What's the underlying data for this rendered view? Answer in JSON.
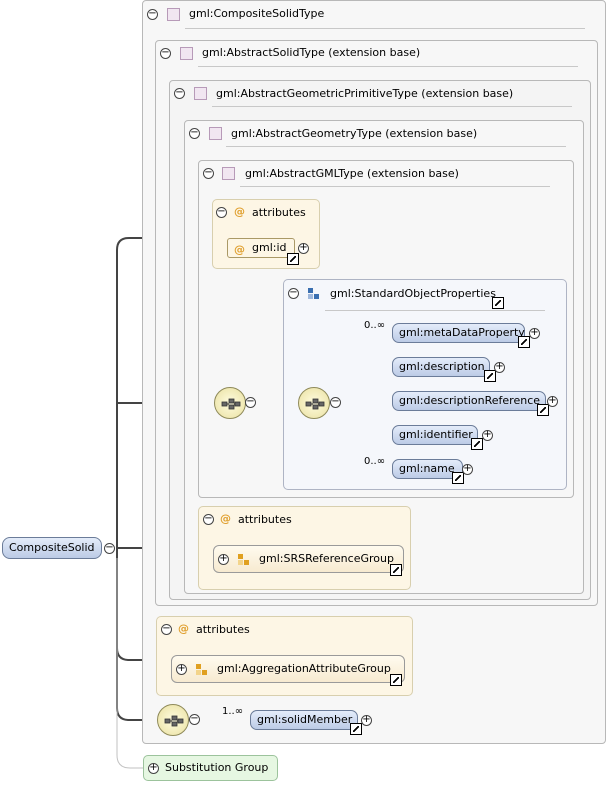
{
  "types": {
    "composite_solid_type": "gml:CompositeSolidType",
    "abstract_solid_type": "gml:AbstractSolidType (extension base)",
    "abstract_geometric_primitive_type": "gml:AbstractGeometricPrimitiveType (extension base)",
    "abstract_geometry_type": "gml:AbstractGeometryType (extension base)",
    "abstract_gml_type": "gml:AbstractGMLType (extension base)"
  },
  "attributes_label": "attributes",
  "attribute_at_symbol": "@",
  "gml_id_attribute": "gml:id",
  "standard_object_properties": {
    "label": "gml:StandardObjectProperties",
    "items": [
      {
        "name": "gml:metaDataProperty",
        "cardinality": "0..∞"
      },
      {
        "name": "gml:description",
        "cardinality": ""
      },
      {
        "name": "gml:descriptionReference",
        "cardinality": ""
      },
      {
        "name": "gml:identifier",
        "cardinality": ""
      },
      {
        "name": "gml:name",
        "cardinality": "0..∞"
      }
    ]
  },
  "srs_reference_group": "gml:SRSReferenceGroup",
  "aggregation_attribute_group": "gml:AggregationAttributeGroup",
  "root_element": "CompositeSolid",
  "solid_member": {
    "name": "gml:solidMember",
    "cardinality": "1..∞"
  },
  "substitution_group": "Substitution Group",
  "toggles": {
    "collapse": "−",
    "expand": "+"
  },
  "colors": {
    "element_fill": "#c8d6ee",
    "attribute_fill": "#fdf6e5",
    "group_fill": "#f5f7fb",
    "substitution_fill": "#e6f7e2"
  }
}
